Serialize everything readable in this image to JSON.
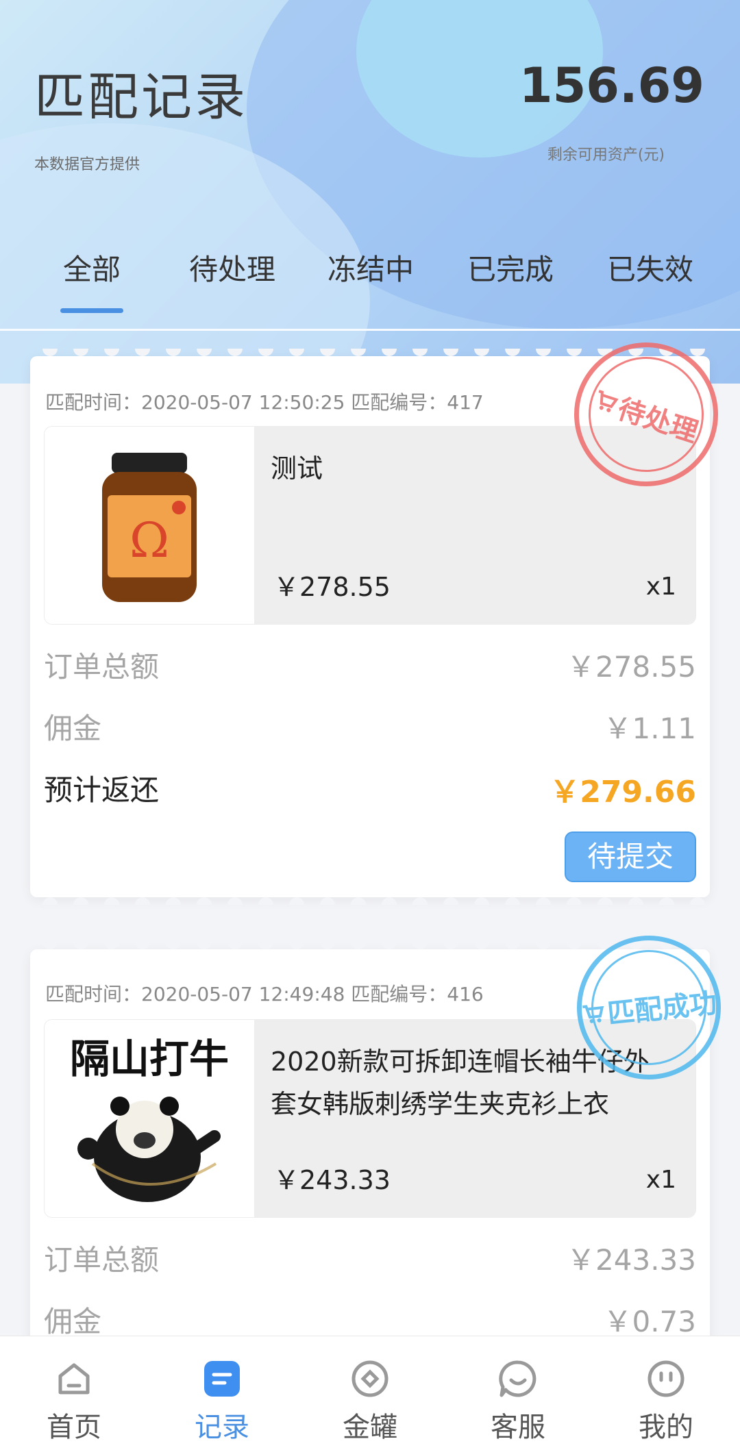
{
  "header": {
    "title": "匹配记录",
    "subtitle": "本数据官方提供",
    "balance": "156.69",
    "balance_label": "剩余可用资产(元)"
  },
  "tabs": [
    {
      "label": "全部",
      "active": true
    },
    {
      "label": "待处理",
      "active": false
    },
    {
      "label": "冻结中",
      "active": false
    },
    {
      "label": "已完成",
      "active": false
    },
    {
      "label": "已失效",
      "active": false
    }
  ],
  "orders": [
    {
      "meta": "匹配时间：2020-05-07 12:50:25  匹配编号：417",
      "stamp": "待处理",
      "product_name": "测试",
      "product_price": "￥278.55",
      "product_qty": "x1",
      "thumb_icon": "supplement-bottle-image",
      "total_label": "订单总额",
      "total_value": "￥278.55",
      "commission_label": "佣金",
      "commission_value": "￥1.11",
      "return_label": "预计返还",
      "return_value": "￥279.66",
      "action_label": "待提交"
    },
    {
      "meta": "匹配时间：2020-05-07 12:49:48  匹配编号：416",
      "stamp": "匹配成功",
      "product_name": "2020新款可拆卸连帽长袖牛仔外套女韩版刺绣学生夹克衫上衣",
      "product_price": "￥243.33",
      "product_qty": "x1",
      "thumb_text": "隔山打牛",
      "thumb_icon": "panda-meme-image",
      "total_label": "订单总额",
      "total_value": "￥243.33",
      "commission_label": "佣金",
      "commission_value": "￥0.73"
    }
  ],
  "bottom_nav": [
    {
      "label": "首页",
      "icon": "home-icon",
      "active": false
    },
    {
      "label": "记录",
      "icon": "record-icon",
      "active": true
    },
    {
      "label": "金罐",
      "icon": "jar-icon",
      "active": false
    },
    {
      "label": "客服",
      "icon": "chat-icon",
      "active": false
    },
    {
      "label": "我的",
      "icon": "profile-icon",
      "active": false
    }
  ],
  "colors": {
    "accent": "#4a90e2",
    "highlight": "#f5a623",
    "stamp_pending": "#ef6b6b",
    "stamp_success": "#4fb8ee",
    "button": "#6cb3f5"
  }
}
